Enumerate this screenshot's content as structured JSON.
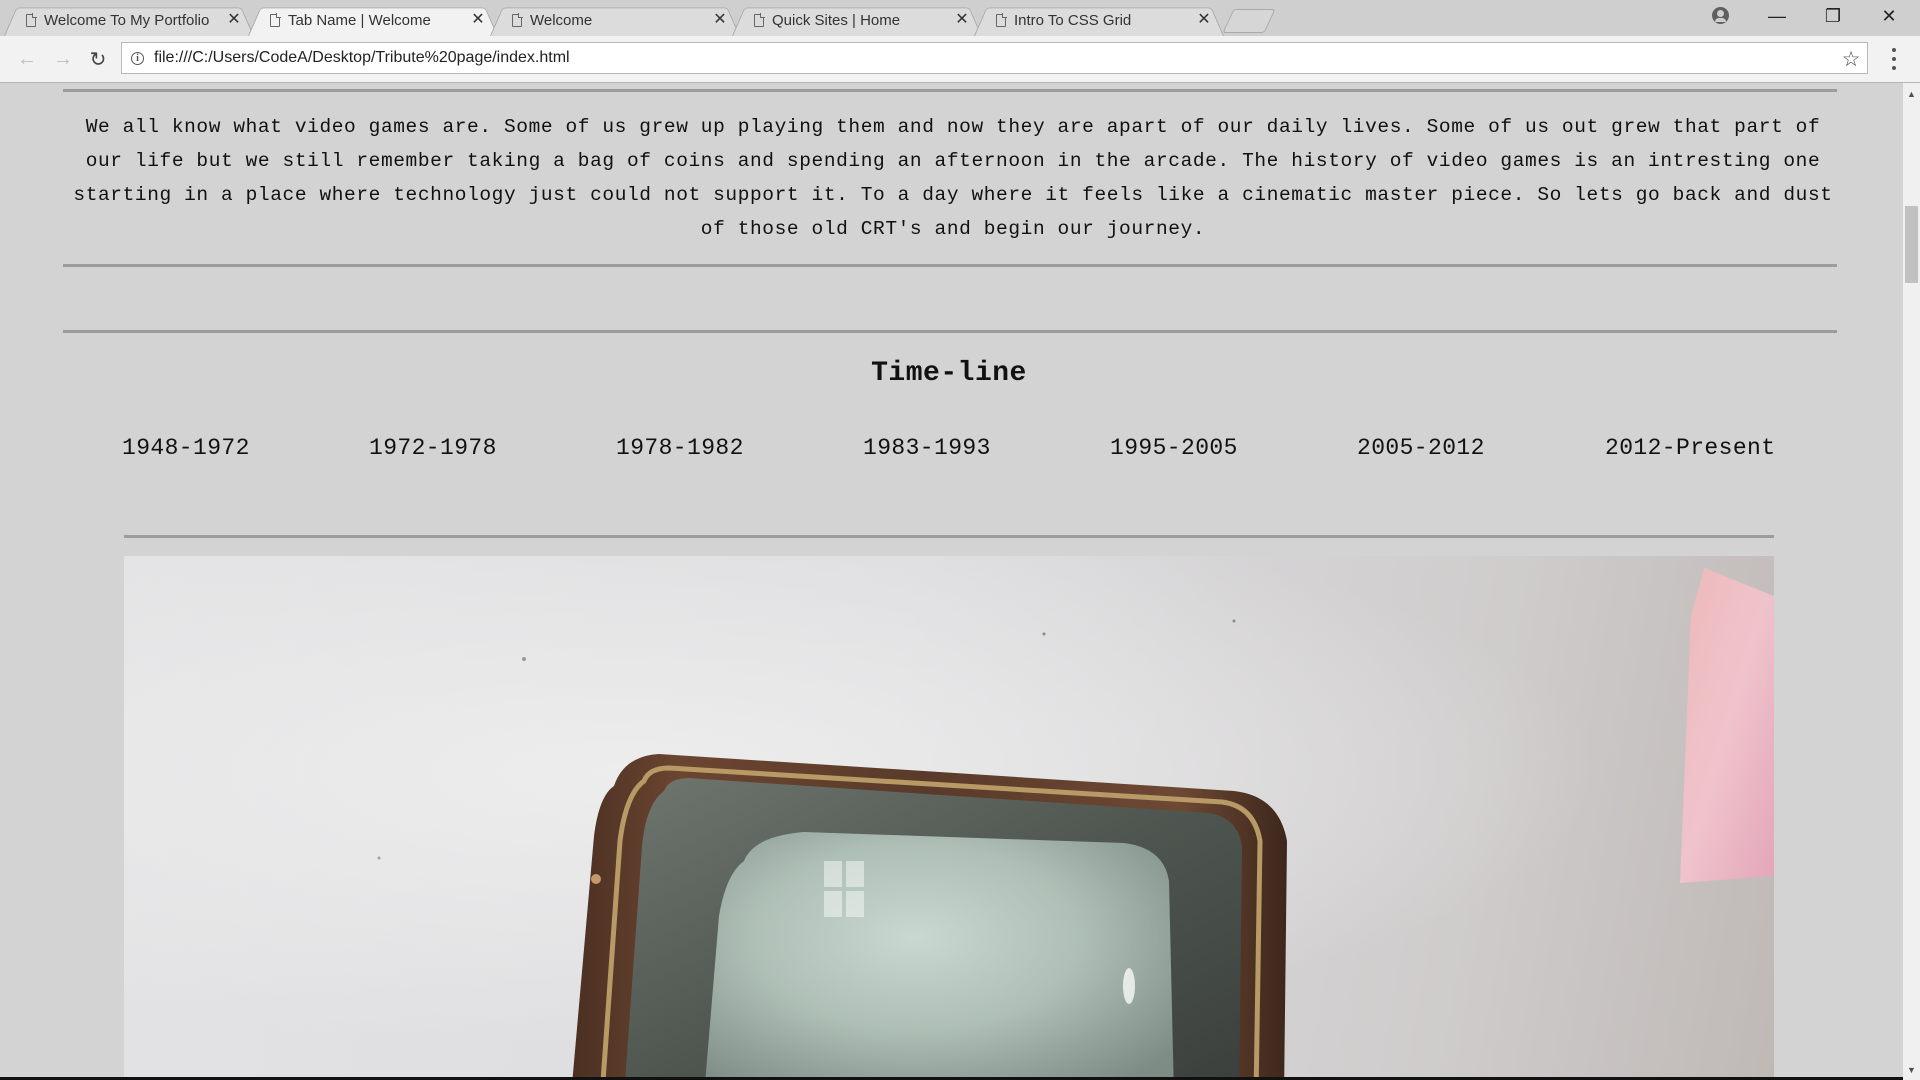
{
  "browser": {
    "tabs": [
      {
        "title": "Welcome To My Portfolio",
        "active": false
      },
      {
        "title": "Tab Name | Welcome",
        "active": true
      },
      {
        "title": "Welcome",
        "active": false
      },
      {
        "title": "Quick Sites | Home",
        "active": false
      },
      {
        "title": "Intro To CSS Grid",
        "active": false
      }
    ],
    "tab_close_glyph": "✕",
    "url": "file:///C:/Users/CodeA/Desktop/Tribute%20page/index.html",
    "icons": {
      "back": "←",
      "forward": "→",
      "reload": "↻",
      "star": "☆",
      "minimize": "—",
      "maximize": "❐",
      "close": "✕",
      "info": "i"
    }
  },
  "page": {
    "intro": "We all know what video games are. Some of us grew up playing them and now they are apart of our daily lives. Some of us out grew that part of our life but we still remember taking a bag of coins and spending an afternoon in the arcade. The history of video games is an intresting one starting in a place where technology just could not support it. To a day where it feels like a cinematic master piece. So lets go back and dust of those old CRT's and begin our journey.",
    "timeline_heading": "Time-line",
    "timeline": [
      "1948-1972",
      "1972-1978",
      "1978-1982",
      "1983-1993",
      "1995-2005",
      "2005-2012",
      "2012-Present"
    ]
  },
  "colors": {
    "page_background": "#d3d3d3",
    "rule": "#9c9c9c",
    "text": "#111111"
  }
}
